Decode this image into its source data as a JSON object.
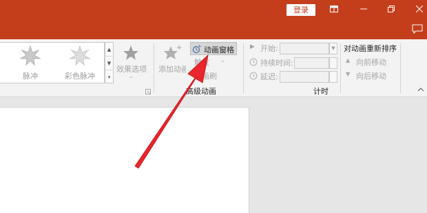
{
  "titlebar": {
    "login_label": "登录",
    "controls": [
      "ribbon-display-icon",
      "minimize-icon",
      "restore-icon",
      "close-icon"
    ]
  },
  "gallery": {
    "items": [
      {
        "label": "脉冲"
      },
      {
        "label": "彩色脉冲"
      }
    ]
  },
  "ribbon": {
    "effect_options": "效果选项",
    "add_animation": "添加动画",
    "animation_pane": "动画窗格",
    "trigger": "触发",
    "animation_painter": "动画刷",
    "advanced_group": "高级动画",
    "start_label": "开始:",
    "duration_label": "持续时间:",
    "delay_label": "延迟:",
    "timing_group": "计时",
    "reorder_title": "对动画重新排序",
    "move_earlier": "向前移动",
    "move_later": "向后移动"
  },
  "colors": {
    "brand": "#c43e1c",
    "arrow": "#e8262b"
  }
}
